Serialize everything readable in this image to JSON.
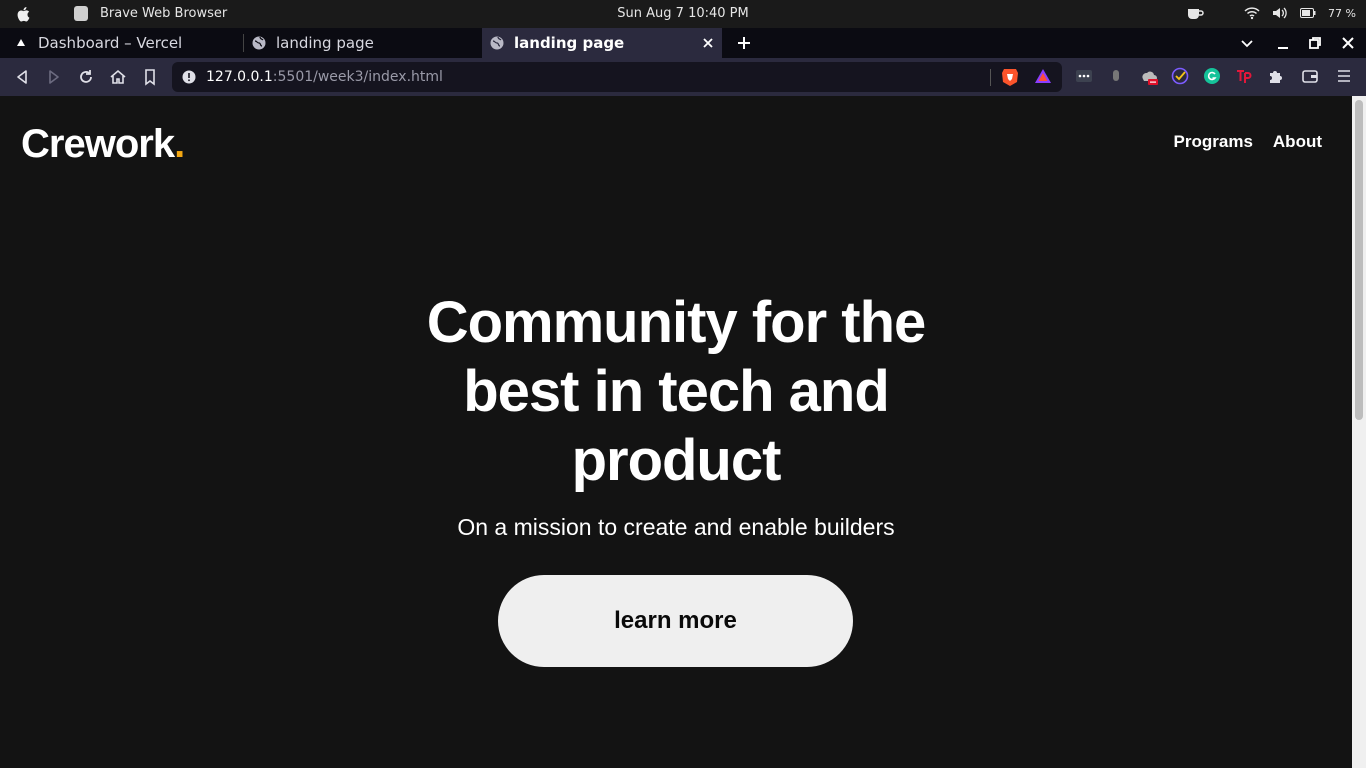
{
  "os": {
    "app_name": "Brave Web Browser",
    "clock": "Sun Aug 7  10:40 PM",
    "battery": "77 %"
  },
  "tabs": [
    {
      "label": "Dashboard – Vercel",
      "icon": "vercel-triangle-icon",
      "active": false
    },
    {
      "label": "landing page",
      "icon": "globe-icon",
      "active": false
    },
    {
      "label": "landing page",
      "icon": "globe-icon",
      "active": true
    }
  ],
  "address_bar": {
    "host": "127.0.0.1",
    "path": ":5501/week3/index.html"
  },
  "site": {
    "logo_text": "Crework",
    "logo_dot": ".",
    "nav": [
      "Programs",
      "About"
    ],
    "hero_title": "Community for the best in tech and product",
    "hero_subtitle": "On a mission to create and enable builders",
    "cta_label": "learn more"
  },
  "colors": {
    "page_bg": "#131313",
    "logo_accent": "#f3a712",
    "browser_chrome": "#2b2a3e",
    "cta_bg": "#efefef"
  }
}
